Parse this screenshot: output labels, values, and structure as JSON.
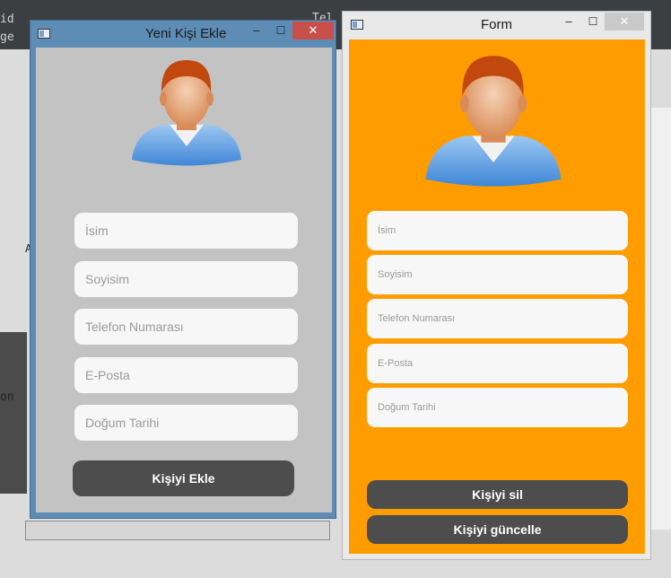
{
  "colors": {
    "left_window_frame": "#5d8db5",
    "left_window_client": "#c3c3c3",
    "right_window_frame": "#e9e9e9",
    "right_window_client": "#ff9d00",
    "close_red": "#c7504b",
    "button_dark": "#4d4d4d",
    "field_bg": "#f7f7f7"
  },
  "left_window": {
    "title": "Yeni Kişi Ekle",
    "minimize_glyph": "–",
    "maximize_glyph": "☐",
    "close_glyph": "✕",
    "fields": [
      {
        "placeholder": "İsim"
      },
      {
        "placeholder": "Soyisim"
      },
      {
        "placeholder": "Telefon Numarası"
      },
      {
        "placeholder": "E-Posta"
      },
      {
        "placeholder": "Doğum Tarihi"
      }
    ],
    "add_button": "Kişiyi Ekle",
    "avatar_icon": "user-avatar-icon"
  },
  "right_window": {
    "title": "Form",
    "minimize_glyph": "–",
    "maximize_glyph": "☐",
    "close_glyph": "✕",
    "fields": [
      {
        "placeholder": "İsim"
      },
      {
        "placeholder": "Soyisim"
      },
      {
        "placeholder": "Telefon Numarası"
      },
      {
        "placeholder": "E-Posta"
      },
      {
        "placeholder": "Doğum Tarihi"
      }
    ],
    "delete_button": "Kişiyi sil",
    "update_button": "Kişiyi güncelle",
    "avatar_icon": "user-avatar-icon"
  },
  "background": {
    "fragments": [
      "id",
      "ge",
      "on",
      "A",
      "Tel"
    ]
  }
}
